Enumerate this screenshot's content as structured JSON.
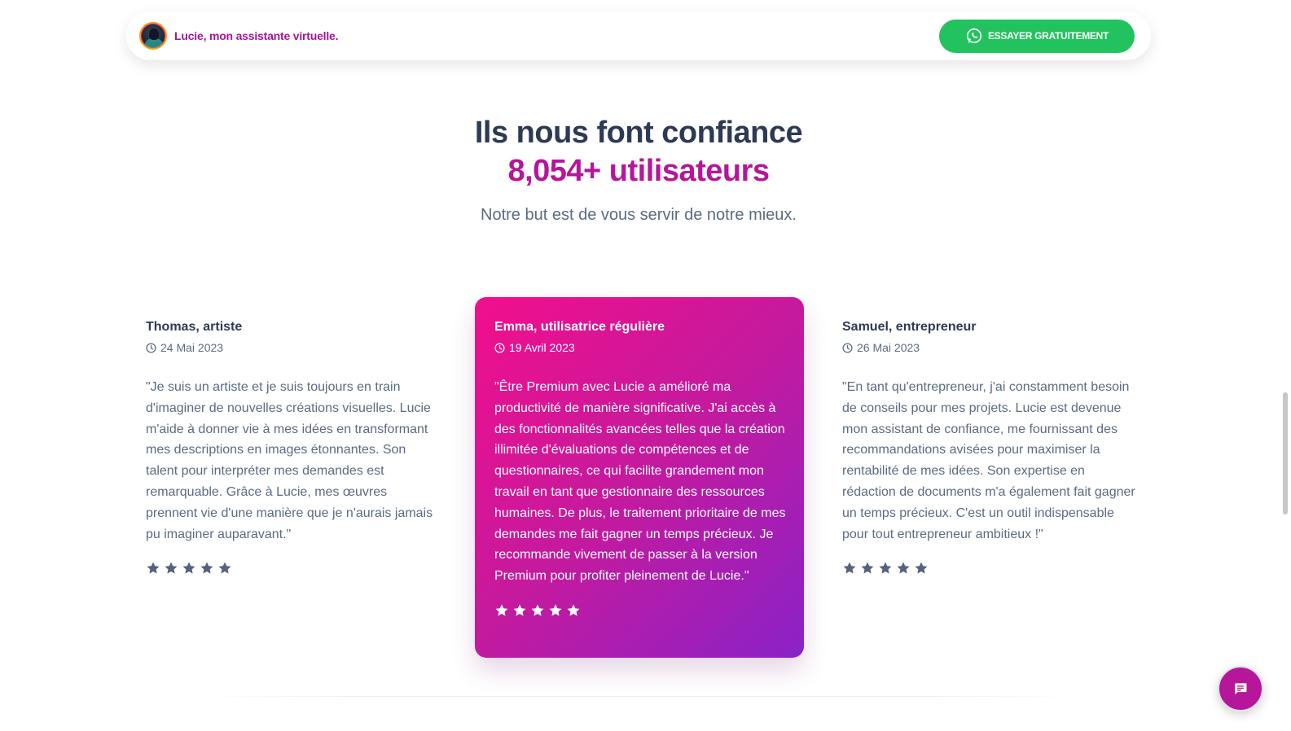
{
  "navbar": {
    "brand_name": "Lucie, mon assistante virtuelle.",
    "cta_label": "ESSAYER GRATUITEMENT",
    "cta_icon": "whatsapp-icon",
    "cta_color": "#22c35e",
    "brand_color": "#a3169c"
  },
  "section": {
    "title": "Ils nous font confiance",
    "count": "8,054+ utilisateurs",
    "subtitle": "Notre but est de vous servir de notre mieux."
  },
  "testimonials": [
    {
      "author": "Thomas, artiste",
      "date": "24 Mai 2023",
      "quote": "\"Je suis un artiste et je suis toujours en train d'imaginer de nouvelles créations visuelles. Lucie m'aide à donner vie à mes idées en transformant mes descriptions en images étonnantes. Son talent pour interpréter mes demandes est remarquable. Grâce à Lucie, mes œuvres prennent vie d'une manière que je n'aurais jamais pu imaginer auparavant.\"",
      "rating": 5
    },
    {
      "author": "Emma, utilisatrice régulière",
      "date": "19 Avril 2023",
      "quote": "\"Être Premium avec Lucie a amélioré ma productivité de manière significative. J'ai accès à des fonctionnalités avancées telles que la création illimitée d'évaluations de compétences et de questionnaires, ce qui facilite grandement mon travail en tant que gestionnaire des ressources humaines. De plus, le traitement prioritaire de mes demandes me fait gagner un temps précieux. Je recommande vivement de passer à la version Premium pour profiter pleinement de Lucie.\"",
      "rating": 5
    },
    {
      "author": "Samuel, entrepreneur",
      "date": "26 Mai 2023",
      "quote": "\"En tant qu'entrepreneur, j'ai constamment besoin de conseils pour mes projets. Lucie est devenue mon assistant de confiance, me fournissant des recommandations avisées pour maximiser la rentabilité de mes idées. Son expertise en rédaction de documents m'a également fait gagner un temps précieux. C'est un outil indispensable pour tout entrepreneur ambitieux !\"",
      "rating": 5
    }
  ],
  "colors": {
    "title": "#2d3a55",
    "accent": "#b5169a",
    "featured_gradient_start": "#f20f8c",
    "featured_gradient_end": "#8a22c7"
  },
  "chat_widget": {
    "icon": "chat-icon"
  }
}
